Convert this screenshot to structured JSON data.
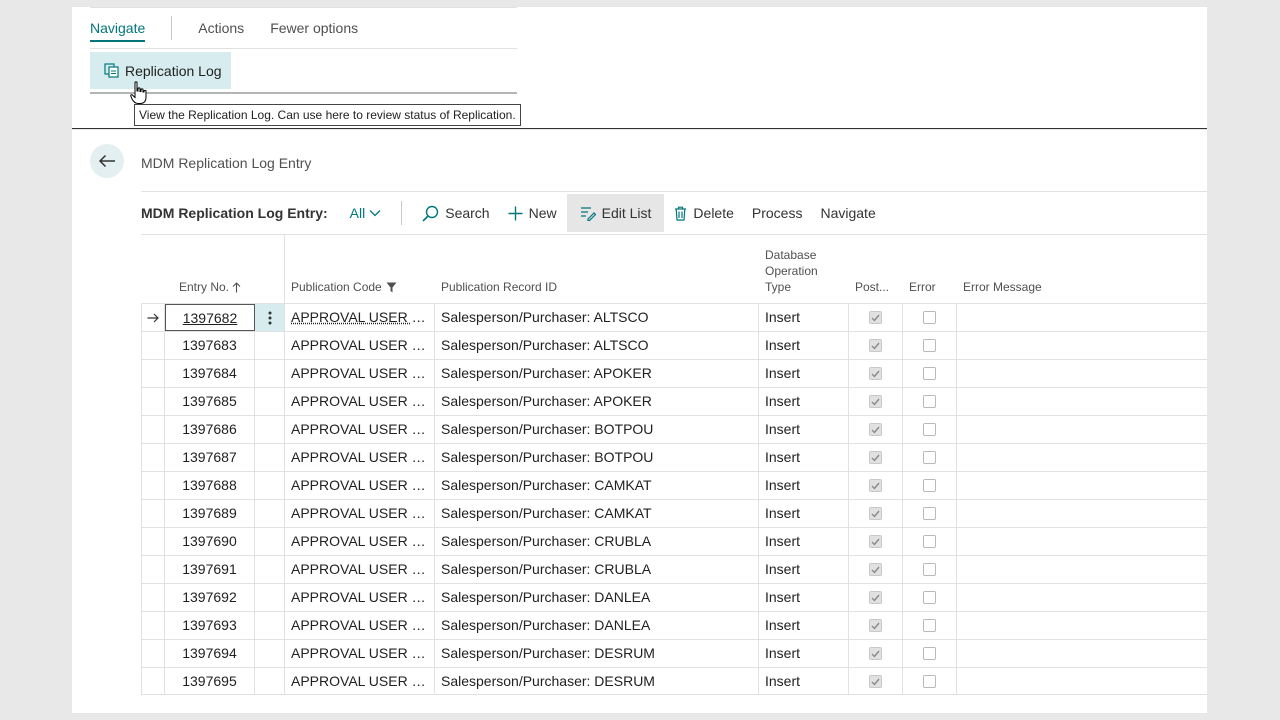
{
  "popup": {
    "tabs": [
      "Navigate",
      "Actions",
      "Fewer options"
    ],
    "replication_button": "Replication Log",
    "tooltip": "View the Replication Log.  Can use here to review status of Replication."
  },
  "page": {
    "title": "MDM Replication Log Entry",
    "list_title": "MDM Replication Log Entry:",
    "filter": "All",
    "actions": {
      "search": "Search",
      "new": "New",
      "edit_list": "Edit List",
      "delete": "Delete",
      "process": "Process",
      "navigate": "Navigate"
    }
  },
  "grid": {
    "headers": {
      "entry_no": "Entry No.",
      "publication_code": "Publication Code",
      "publication_record_id": "Publication Record ID",
      "db_op_line1": "Database",
      "db_op_line2": "Operation",
      "db_op_line3": "Type",
      "posted": "Post...",
      "error": "Error",
      "error_message": "Error Message"
    },
    "rows": [
      {
        "entry": "1397682",
        "pub": "APPROVAL USER SET...",
        "rec": "Salesperson/Purchaser: ALTSCO",
        "op": "Insert"
      },
      {
        "entry": "1397683",
        "pub": "APPROVAL USER SET...",
        "rec": "Salesperson/Purchaser: ALTSCO",
        "op": "Insert"
      },
      {
        "entry": "1397684",
        "pub": "APPROVAL USER SET...",
        "rec": "Salesperson/Purchaser: APOKER",
        "op": "Insert"
      },
      {
        "entry": "1397685",
        "pub": "APPROVAL USER SET...",
        "rec": "Salesperson/Purchaser: APOKER",
        "op": "Insert"
      },
      {
        "entry": "1397686",
        "pub": "APPROVAL USER SET...",
        "rec": "Salesperson/Purchaser: BOTPOU",
        "op": "Insert"
      },
      {
        "entry": "1397687",
        "pub": "APPROVAL USER SET...",
        "rec": "Salesperson/Purchaser: BOTPOU",
        "op": "Insert"
      },
      {
        "entry": "1397688",
        "pub": "APPROVAL USER SET...",
        "rec": "Salesperson/Purchaser: CAMKAT",
        "op": "Insert"
      },
      {
        "entry": "1397689",
        "pub": "APPROVAL USER SET...",
        "rec": "Salesperson/Purchaser: CAMKAT",
        "op": "Insert"
      },
      {
        "entry": "1397690",
        "pub": "APPROVAL USER SET...",
        "rec": "Salesperson/Purchaser: CRUBLA",
        "op": "Insert"
      },
      {
        "entry": "1397691",
        "pub": "APPROVAL USER SET...",
        "rec": "Salesperson/Purchaser: CRUBLA",
        "op": "Insert"
      },
      {
        "entry": "1397692",
        "pub": "APPROVAL USER SET...",
        "rec": "Salesperson/Purchaser: DANLEA",
        "op": "Insert"
      },
      {
        "entry": "1397693",
        "pub": "APPROVAL USER SET...",
        "rec": "Salesperson/Purchaser: DANLEA",
        "op": "Insert"
      },
      {
        "entry": "1397694",
        "pub": "APPROVAL USER SET...",
        "rec": "Salesperson/Purchaser: DESRUM",
        "op": "Insert"
      },
      {
        "entry": "1397695",
        "pub": "APPROVAL USER SET...",
        "rec": "Salesperson/Purchaser: DESRUM",
        "op": "Insert"
      }
    ]
  },
  "colors": {
    "accent": "#00777d",
    "highlight": "#d6ecee"
  }
}
